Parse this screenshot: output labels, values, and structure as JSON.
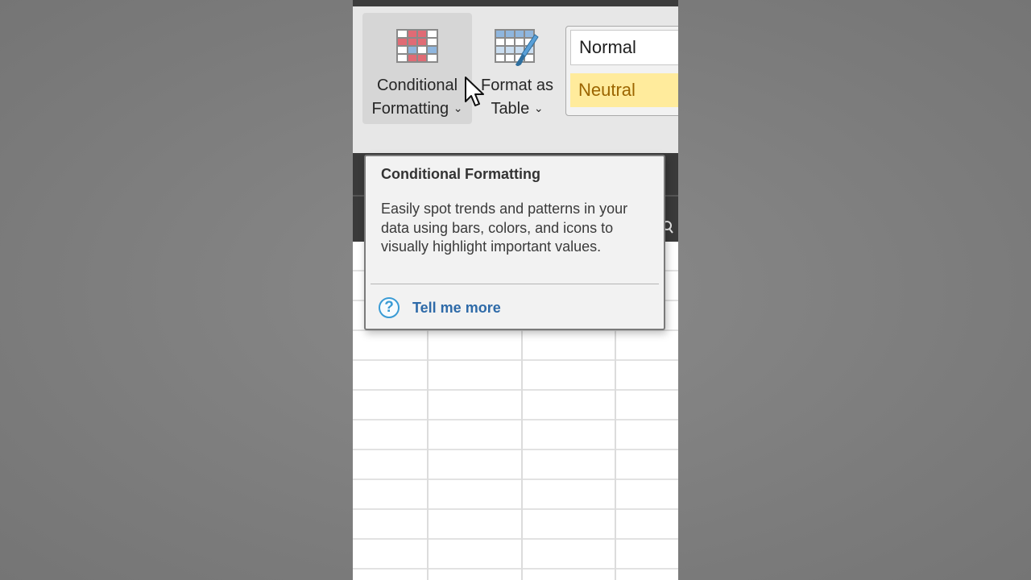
{
  "ribbon": {
    "conditional_formatting": {
      "line1": "Conditional",
      "line2": "Formatting",
      "icon": "conditional-formatting-icon"
    },
    "format_as_table": {
      "line1": "Format as",
      "line2": "Table",
      "icon": "format-as-table-icon"
    },
    "chevron": "⌄",
    "cell_styles": {
      "normal": "Normal",
      "neutral": "Neutral"
    }
  },
  "tooltip": {
    "title": "Conditional Formatting",
    "description": "Easily spot trends and patterns in your data using bars, colors, and icons to visually highlight important values.",
    "link_label": "Tell me more",
    "help_icon": "?"
  },
  "colors": {
    "neutral_fill": "#ffeb9c",
    "neutral_text": "#9c6500",
    "link": "#2e6aa8",
    "help_icon": "#3a9bd5"
  }
}
